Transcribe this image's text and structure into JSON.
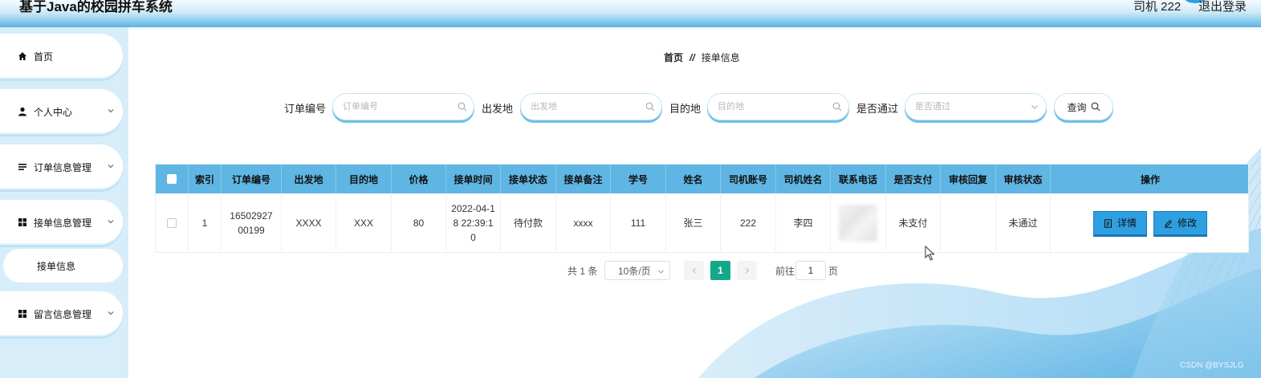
{
  "header": {
    "app_title": "基于Java的校园拼车系统",
    "user_label": "司机 222",
    "logout_label": "退出登录"
  },
  "sidebar": {
    "items": [
      {
        "label": "首页",
        "icon": "home-icon"
      },
      {
        "label": "个人中心",
        "icon": "user-icon"
      },
      {
        "label": "订单信息管理",
        "icon": "list-icon"
      },
      {
        "label": "接单信息管理",
        "icon": "grid-icon"
      },
      {
        "label": "留言信息管理",
        "icon": "grid-icon"
      }
    ],
    "sub_item": "接单信息"
  },
  "breadcrumb": {
    "home": "首页",
    "separator": "//",
    "current": "接单信息"
  },
  "search": {
    "order_no_label": "订单编号",
    "order_no_placeholder": "订单编号",
    "origin_label": "出发地",
    "origin_placeholder": "出发地",
    "destination_label": "目的地",
    "destination_placeholder": "目的地",
    "approved_label": "是否通过",
    "approved_placeholder": "是否通过",
    "query_label": "查询"
  },
  "table": {
    "columns": [
      "索引",
      "订单编号",
      "出发地",
      "目的地",
      "价格",
      "接单时间",
      "接单状态",
      "接单备注",
      "学号",
      "姓名",
      "司机账号",
      "司机姓名",
      "联系电话",
      "是否支付",
      "审核回复",
      "审核状态",
      "操作"
    ],
    "rows": [
      {
        "index": "1",
        "order_no": "1650292700199",
        "origin": "XXXX",
        "destination": "XXX",
        "price": "80",
        "time": "2022-04-18 22:39:10",
        "status": "待付款",
        "remark": "xxxx",
        "student_no": "111",
        "name": "张三",
        "driver_account": "222",
        "driver_name": "李四",
        "phone": "",
        "paid": "未支付",
        "review_reply": "",
        "review_status": "未通过"
      }
    ],
    "actions": {
      "detail": "详情",
      "edit": "修改"
    }
  },
  "pagination": {
    "total": "共 1 条",
    "page_size": "10条/页",
    "current_page": "1",
    "goto_prefix": "前往",
    "goto_value": "1",
    "goto_suffix": "页"
  },
  "watermark": "CSDN @BYSJLG",
  "colors": {
    "header_blue": "#5ab4e2",
    "table_header": "#5fb6e4",
    "action_button": "#2e9fe0",
    "pager_active": "#14a88a",
    "sidebar_bg": "#d7eefa"
  }
}
